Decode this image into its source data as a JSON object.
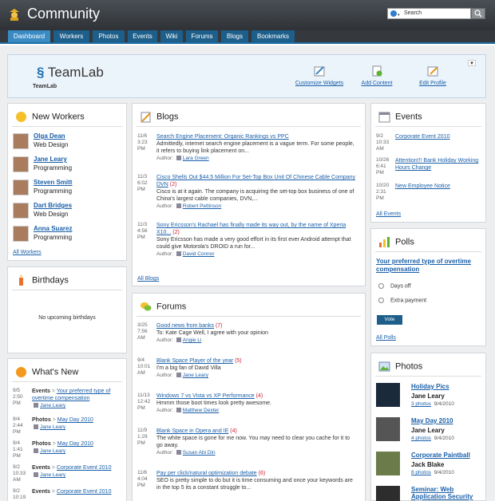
{
  "app": {
    "title": "Community"
  },
  "search": {
    "placeholder": "Search"
  },
  "nav": [
    {
      "label": "Dashboard",
      "active": true
    },
    {
      "label": "Workers"
    },
    {
      "label": "Photos"
    },
    {
      "label": "Events"
    },
    {
      "label": "Wiki"
    },
    {
      "label": "Forums"
    },
    {
      "label": "Blogs"
    },
    {
      "label": "Bookmarks"
    }
  ],
  "header": {
    "logo": "TeamLab",
    "logo_sub": "TeamLab",
    "actions": [
      "Customize Widgets",
      "Add Content",
      "Edit Profile"
    ]
  },
  "new_workers": {
    "title": "New Workers",
    "items": [
      {
        "name": "Olga Dean",
        "dept": "Web Design"
      },
      {
        "name": "Jane Leary",
        "dept": "Programming"
      },
      {
        "name": "Steven Smitt",
        "dept": "Programming"
      },
      {
        "name": "Dart Bridges",
        "dept": "Web Design"
      },
      {
        "name": "Anna Suarez",
        "dept": "Programming"
      }
    ],
    "all_link": "All Workers"
  },
  "birthdays": {
    "title": "Birthdays",
    "empty": "No upcoming birthdays"
  },
  "whats_new": {
    "title": "What's New",
    "items": [
      {
        "date": "9/5",
        "time": "2:50",
        "ampm": "PM",
        "type": "Events",
        "sep": ">",
        "link": "Your preferred type of overtime compensation",
        "author": "Jane Leary"
      },
      {
        "date": "9/4",
        "time": "2:44",
        "ampm": "PM",
        "type": "Photos",
        "sep": ">",
        "link": "May Day 2010",
        "author": "Jane Leary"
      },
      {
        "date": "9/4",
        "time": "1:41",
        "ampm": "PM",
        "type": "Photos",
        "sep": ">",
        "link": "May Day 2010",
        "author": "Jane Leary"
      },
      {
        "date": "9/2",
        "time": "10:33",
        "ampm": "AM",
        "type": "Events",
        "sep": ">",
        "link": "Corporate Event 2010",
        "author": "Jane Leary"
      },
      {
        "date": "9/2",
        "time": "10:19",
        "ampm": "",
        "type": "Events",
        "sep": ">",
        "link": "Corporate Event 2010",
        "author": ""
      }
    ]
  },
  "blogs": {
    "title": "Blogs",
    "author_label": "Author:",
    "items": [
      {
        "date": "11/6",
        "time": "3:23",
        "ampm": "PM",
        "title": "Search Engine Placement: Organic Rankings vs PPC",
        "count": "",
        "text": "Admittedly, internet search engine placement is a vague term. For some people, it refers to buying link placement on...",
        "author": "Lara Green"
      },
      {
        "date": "11/3",
        "time": "6:02",
        "ampm": "PM",
        "title": "Cisco Shells Out $44.5 Million For Set-Top Box Unit Of Chinese Cable Company DVN",
        "count": "(2)",
        "text": "Cisco is at it again. The company is acquiring the set-top box business of one of China's largest cable companies, DVN,...",
        "author": "Robert Pettinson"
      },
      {
        "date": "11/3",
        "time": "4:56",
        "ampm": "PM",
        "title": "Sony Ericsson's Rachael has finally made its way out, by the name of Xperia X10...",
        "count": "(2)",
        "text": "Sony Ericsson has made a very good effort in its first ever Android attempt that could give Motorola's DROID a run for...",
        "author": "David Connor"
      }
    ],
    "all_link": "All Blogs"
  },
  "forums": {
    "title": "Forums",
    "author_label": "Author:",
    "items": [
      {
        "date": "3/25",
        "time": "7:56",
        "ampm": "AM",
        "title": "Good news from banks",
        "count": "(7)",
        "text": "To: Kate Cage Well, I agree with your opinion",
        "author": "Angie Li"
      },
      {
        "date": "9/4",
        "time": "10:01",
        "ampm": "AM",
        "title": "Blank Space Player of the year",
        "count": "(5)",
        "text": "I'm a big fan of David Villa",
        "author": "Jane Leary"
      },
      {
        "date": "11/13",
        "time": "12:42",
        "ampm": "PM",
        "title": "Windows 7 vs Vista vs XP Performance",
        "count": "(4)",
        "text": "Hmmm those boot times look pretty awesome.",
        "author": "Matthew Dexter"
      },
      {
        "date": "11/9",
        "time": "1:29",
        "ampm": "PM",
        "title": "Blank Space in Opera and IE",
        "count": "(4)",
        "text": "The white space is gone for me now. You may need to clear you cache for it to go away.",
        "author": "Susan Abi Din"
      },
      {
        "date": "11/6",
        "time": "4:04",
        "ampm": "PM",
        "title": "Pay per click/natural optimization debate",
        "count": "(6)",
        "text": "SEO is pretty simple to do but it is time consuming and once your keywords are in the top 5 its a constant struggle to...",
        "author": ""
      }
    ]
  },
  "events": {
    "title": "Events",
    "items": [
      {
        "date": "9/2",
        "time": "10:33",
        "ampm": "AM",
        "title": "Corporate Event 2010"
      },
      {
        "date": "10/26",
        "time": "6:41",
        "ampm": "PM",
        "title": "Attention!!! Bank Holiday Working Hours Change"
      },
      {
        "date": "10/20",
        "time": "2:31",
        "ampm": "PM",
        "title": "New Employee Notice"
      }
    ],
    "all_link": "All Events"
  },
  "polls": {
    "title": "Polls",
    "question": "Your preferred type of overtime compensation",
    "options": [
      "Days off",
      "Extra payment"
    ],
    "vote": "Vote",
    "all_link": "All Polls"
  },
  "photos": {
    "title": "Photos",
    "items": [
      {
        "title": "Holiday Pics",
        "author": "Jane Leary",
        "count": "3 photos",
        "date": "9/4/2010"
      },
      {
        "title": "May Day 2010",
        "author": "Jane Leary",
        "count": "4 photos",
        "date": "9/4/2010"
      },
      {
        "title": "Corporate Paintball",
        "author": "Jack Blake",
        "count": "8 photos",
        "date": "9/4/2010"
      },
      {
        "title": "Seminar: Web Application Security",
        "author": "",
        "count": "",
        "date": ""
      }
    ]
  },
  "colors": {
    "nav_bg": "#35393d",
    "tab": "#1d5f8a",
    "tab_active": "#3a8ac3",
    "link": "#1a5fa8",
    "count": "#cc2233"
  }
}
